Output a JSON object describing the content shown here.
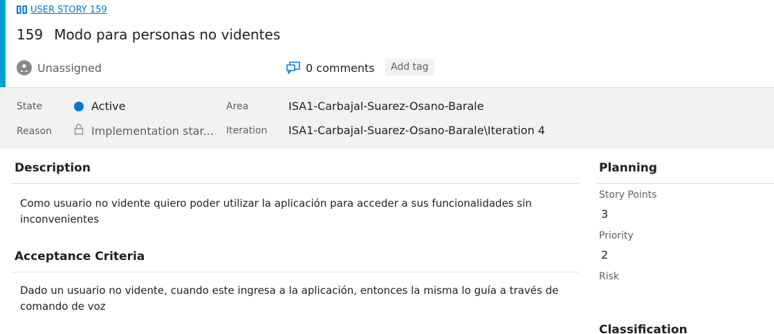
{
  "header": {
    "work_item_type": "USER STORY 159",
    "id": "159",
    "title": "Modo para personas no videntes",
    "assignee": "Unassigned",
    "comments": "0 comments",
    "add_tag": "Add tag"
  },
  "colors": {
    "accent": "#009ccc",
    "link": "#0078d4",
    "state_active": "#0078d4"
  },
  "details": {
    "state_label": "State",
    "state_value": "Active",
    "reason_label": "Reason",
    "reason_value": "Implementation star...",
    "area_label": "Area",
    "area_value": "ISA1-Carbajal-Suarez-Osano-Barale",
    "iteration_label": "Iteration",
    "iteration_value": "ISA1-Carbajal-Suarez-Osano-Barale\\Iteration 4"
  },
  "description": {
    "title": "Description",
    "text": "Como usuario no vidente quiero poder utilizar la aplicación para acceder a sus funcionalidades sin inconvenientes"
  },
  "acceptance": {
    "title": "Acceptance Criteria",
    "text": "Dado un usuario no vidente, cuando este ingresa a la aplicación, entonces la misma lo guía a través de comando de voz"
  },
  "planning": {
    "title": "Planning",
    "story_points_label": "Story Points",
    "story_points_value": "3",
    "priority_label": "Priority",
    "priority_value": "2",
    "risk_label": "Risk",
    "risk_value": ""
  },
  "classification": {
    "title": "Classification"
  },
  "icons": {
    "type": "book-icon",
    "assignee": "avatar-icon",
    "comments": "comments-icon",
    "reason": "lock-icon"
  }
}
